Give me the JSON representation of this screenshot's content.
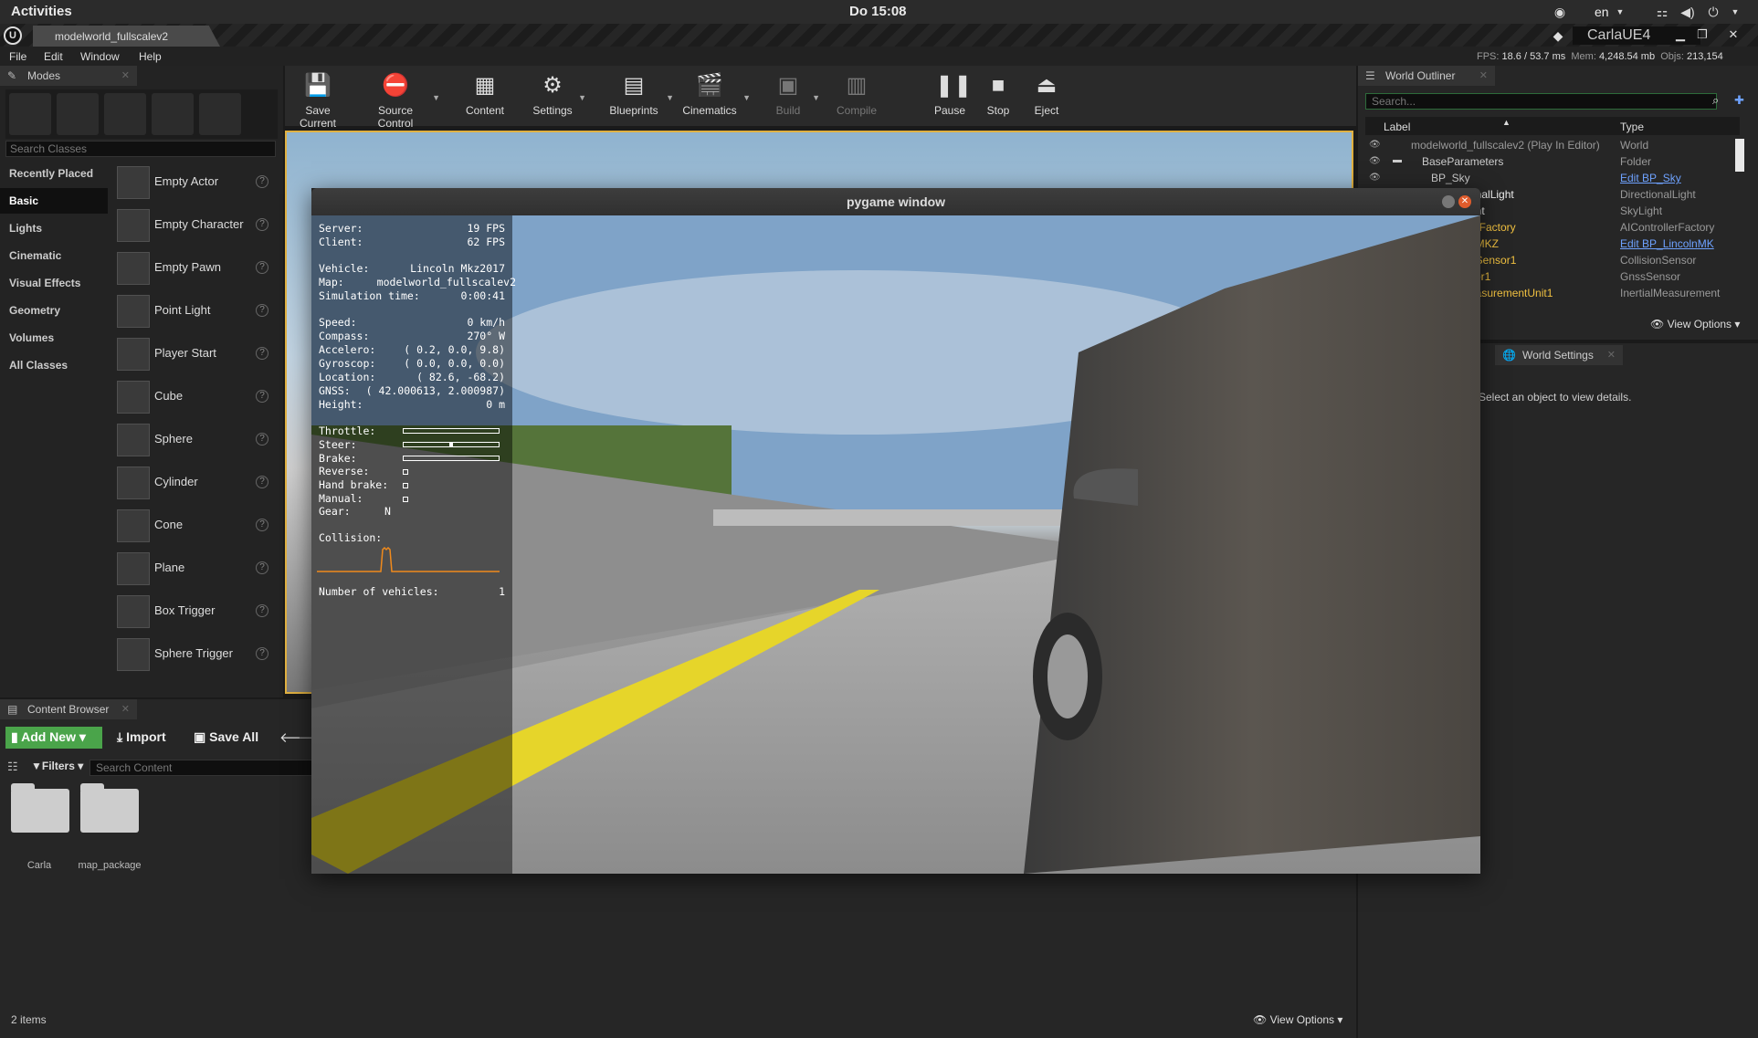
{
  "system": {
    "activities": "Activities",
    "clock": "Do 15:08",
    "language": "en"
  },
  "window": {
    "tab_title": "modelworld_fullscalev2",
    "project_name": "CarlaUE4"
  },
  "menu": {
    "items": [
      "File",
      "Edit",
      "Window",
      "Help"
    ]
  },
  "stats": {
    "fps_label": "FPS:",
    "fps": "18.6",
    "ms": "/ 53.7 ms",
    "mem_label": "Mem:",
    "mem": "4,248.54 mb",
    "objs_label": "Objs:",
    "objs": "213,154"
  },
  "modes": {
    "tab": "Modes",
    "search_placeholder": "Search Classes",
    "categories": [
      "Recently Placed",
      "Basic",
      "Lights",
      "Cinematic",
      "Visual Effects",
      "Geometry",
      "Volumes",
      "All Classes"
    ],
    "selected_category": "Basic",
    "items": [
      "Empty Actor",
      "Empty Character",
      "Empty Pawn",
      "Point Light",
      "Player Start",
      "Cube",
      "Sphere",
      "Cylinder",
      "Cone",
      "Plane",
      "Box Trigger",
      "Sphere Trigger"
    ]
  },
  "toolbar": {
    "buttons": [
      "Save Current",
      "Source Control",
      "Content",
      "Settings",
      "Blueprints",
      "Cinematics",
      "Build",
      "Compile",
      "Pause",
      "Stop",
      "Eject"
    ]
  },
  "outliner": {
    "tab": "World Outliner",
    "search_placeholder": "Search...",
    "col_label": "Label",
    "col_type": "Type",
    "rows": [
      {
        "label": "modelworld_fullscalev2 (Play In Editor)",
        "type": "World"
      },
      {
        "label": "BaseParameters",
        "type": "Folder"
      },
      {
        "label": "BP_Sky",
        "type": "Edit BP_Sky"
      },
      {
        "label": "onalLight",
        "type": "DirectionalLight"
      },
      {
        "label": "ght",
        "type": "SkyLight"
      },
      {
        "label": "erFactory",
        "type": "AIControllerFactory"
      },
      {
        "label": "nMKZ",
        "type": "Edit BP_LincolnMK"
      },
      {
        "label": "nSensor1",
        "type": "CollisionSensor"
      },
      {
        "label": "sor1",
        "type": "GnssSensor"
      },
      {
        "label": "easurementUnit1",
        "type": "InertialMeasurement"
      }
    ],
    "view_options": "View Options"
  },
  "details": {
    "tab": "World Settings",
    "empty_text": "Select an object to view details."
  },
  "content_browser": {
    "tab": "Content Browser",
    "add_new": "Add New",
    "import": "Import",
    "save_all": "Save All",
    "filters": "Filters",
    "search_placeholder": "Search Content",
    "folders": [
      "Carla",
      "map_package"
    ],
    "item_count": "2 items",
    "view_options": "View Options"
  },
  "pygame": {
    "title": "pygame window",
    "hud": {
      "server_label": "Server:",
      "server": "19 FPS",
      "client_label": "Client:",
      "client": "62 FPS",
      "vehicle_label": "Vehicle:",
      "vehicle": "Lincoln Mkz2017",
      "map_label": "Map:",
      "map": "modelworld_fullscalev2",
      "simtime_label": "Simulation time:",
      "simtime": "0:00:41",
      "speed_label": "Speed:",
      "speed": "0 km/h",
      "compass_label": "Compass:",
      "compass": "270° W",
      "accelero_label": "Accelero:",
      "accelero": "( 0.2, 0.0, 9.8)",
      "gyroscop_label": "Gyroscop:",
      "gyroscop": "( 0.0, 0.0, 0.0)",
      "location_label": "Location:",
      "location": "( 82.6, -68.2)",
      "gnss_label": "GNSS:",
      "gnss": "( 42.000613, 2.000987)",
      "height_label": "Height:",
      "height": "0 m",
      "throttle_label": "Throttle:",
      "steer_label": "Steer:",
      "brake_label": "Brake:",
      "reverse_label": "Reverse:",
      "handbrake_label": "Hand brake:",
      "manual_label": "Manual:",
      "gear_label": "Gear:",
      "gear": "N",
      "collision_label": "Collision:",
      "vehicles_label": "Number of vehicles:",
      "vehicles": "1",
      "throttle_level": 0,
      "steer_level": 0.5,
      "brake_level": 0
    }
  }
}
